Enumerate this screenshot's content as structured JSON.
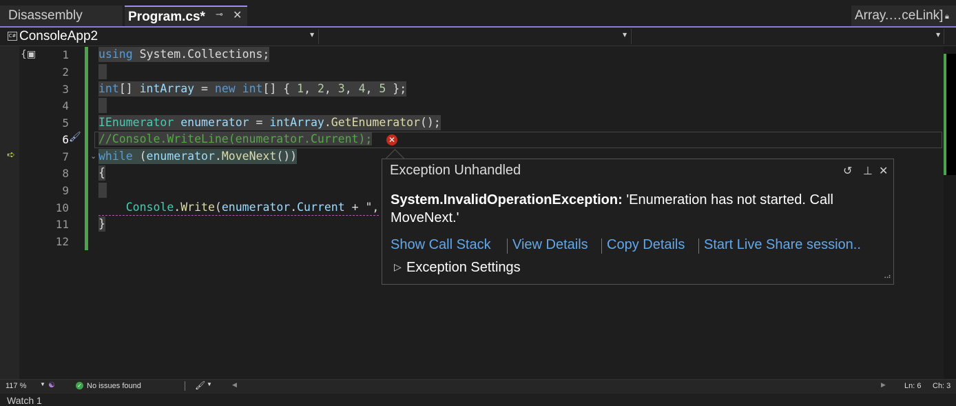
{
  "tabs": {
    "disassembly": "Disassembly",
    "program": "Program.cs*",
    "right": "Array.…ceLink]"
  },
  "navbar": {
    "project": "ConsoleApp2"
  },
  "editor": {
    "line_numbers": [
      "1",
      "2",
      "3",
      "4",
      "5",
      "6",
      "7",
      "8",
      "9",
      "10",
      "11",
      "12"
    ],
    "lines": {
      "l1": {
        "kw": "using",
        "rest": " System.Collections;"
      },
      "l3": {
        "t1": "int",
        "t2": "[] ",
        "t3": "intArray",
        "t4": " = ",
        "t5": "new",
        "t6": " ",
        "t7": "int",
        "t8": "[] { ",
        "t9": "1",
        "t10": ", ",
        "t11": "2",
        "t12": ", ",
        "t13": "3",
        "t14": ", ",
        "t15": "4",
        "t16": ", ",
        "t17": "5",
        "t18": " };"
      },
      "l5": {
        "t1": "IEnumerator",
        "t2": " ",
        "t3": "enumerator",
        "t4": " = ",
        "t5": "intArray",
        "t6": ".",
        "t7": "GetEnumerator",
        "t8": "();"
      },
      "l6": {
        "text": "//Console.WriteLine(enumerator.Current);"
      },
      "l7": {
        "t1": "while",
        "t2": " (",
        "t3": "enumerator",
        "t4": ".",
        "t5": "MoveNext",
        "t6": "())"
      },
      "l8": {
        "text": "{"
      },
      "l10": {
        "t1": "Console",
        "t2": ".",
        "t3": "Write",
        "t4": "(",
        "t5": "enumerator",
        "t6": ".",
        "t7": "Current",
        "t8": " + \","
      },
      "l11": {
        "text": "}"
      }
    }
  },
  "exception": {
    "title": "Exception Unhandled",
    "type": "System.InvalidOperationException:",
    "message": "'Enumeration has not started. Call MoveNext.'",
    "links": {
      "call_stack": "Show Call Stack",
      "view_details": "View Details",
      "copy_details": "Copy Details",
      "live_share": "Start Live Share session.."
    },
    "settings": "Exception Settings",
    "icons": [
      "history-icon",
      "pin-icon",
      "close-icon"
    ]
  },
  "statusbar": {
    "zoom": "117 %",
    "issues": "No issues found",
    "line": "Ln: 6",
    "col": "Ch: 3"
  },
  "bottom": {
    "watch": "Watch 1"
  },
  "colors": {
    "accent": "#8a7bd6",
    "keyword": "#569cd6",
    "type": "#4ec9b0",
    "method": "#dcdcaa",
    "comment": "#57a64a",
    "number": "#b5cea8",
    "link": "#62a8ea",
    "error": "#c42b1c",
    "change_bar": "#4aa44a"
  }
}
